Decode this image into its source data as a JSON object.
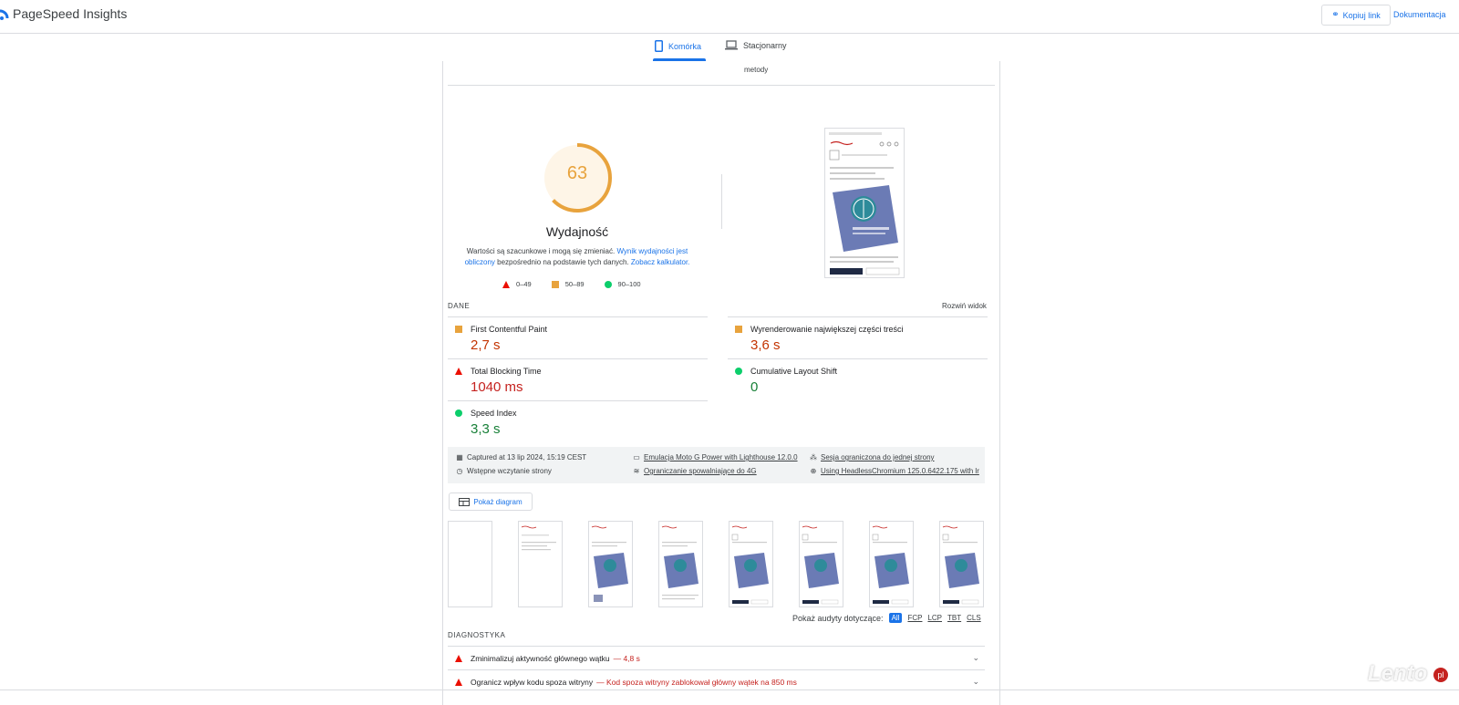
{
  "app": {
    "title": "PageSpeed Insights"
  },
  "header": {
    "copy_link": "Kopiuj link",
    "docs": "Dokumentacja"
  },
  "tabs": [
    {
      "label": "Komórka",
      "active": true
    },
    {
      "label": "Stacjonarny",
      "active": false
    }
  ],
  "report": {
    "method_text": "metody",
    "score": 63,
    "score_color": "#e8a33d",
    "category": "Wydajność",
    "desc_plain_1": "Wartości są szacunkowe i mogą się zmieniać. ",
    "desc_link_1": "Wynik wydajności jest obliczony",
    "desc_plain_2": " bezpośrednio na podstawie tych danych. ",
    "desc_link_2": "Zobacz kalkulator.",
    "legend": {
      "fail": "0–49",
      "average": "50–89",
      "pass": "90–100"
    },
    "section_label": "DANE",
    "expand_view": "Rozwiń widok",
    "metrics": [
      {
        "name": "First Contentful Paint",
        "value": "2,7 s",
        "status": "average"
      },
      {
        "name": "Wyrenderowanie największej części treści",
        "value": "3,6 s",
        "status": "average"
      },
      {
        "name": "Total Blocking Time",
        "value": "1040 ms",
        "status": "fail"
      },
      {
        "name": "Cumulative Layout Shift",
        "value": "0",
        "status": "pass"
      },
      {
        "name": "Speed Index",
        "value": "3,3 s",
        "status": "pass"
      }
    ],
    "runtime": {
      "captured": "Captured at 13 lip 2024, 15:19 CEST",
      "initial_load": "Wstępne wczytanie strony",
      "emulation": "Emulacja Moto G Power with Lighthouse 12.0.0",
      "throttling": "Ograniczanie spowalniające do 4G",
      "session": "Sesja ograniczona do jednej strony",
      "browser": "Using HeadlessChromium 125.0.6422.175 with lr"
    },
    "show_diagram": "Pokaż diagram",
    "audits_filter": {
      "label": "Pokaż audyty dotyczące:",
      "chips": [
        "All",
        "FCP",
        "LCP",
        "TBT",
        "CLS"
      ],
      "active": "All"
    },
    "diagnostics_label": "DIAGNOSTYKA",
    "diagnostics": [
      {
        "title": "Zminimalizuj aktywność głównego wątku",
        "detail": "— 4,8 s"
      },
      {
        "title": "Ogranicz wpływ kodu spoza witryny",
        "detail": "— Kod spoza witryny zablokował główny wątek na 850 ms"
      }
    ]
  },
  "watermark": {
    "text": "Lento",
    "badge": "pl"
  },
  "colors": {
    "accent": "#1a73e8",
    "fail": "#eb0f00",
    "average": "#e8a33d",
    "pass": "#0cce6b"
  }
}
